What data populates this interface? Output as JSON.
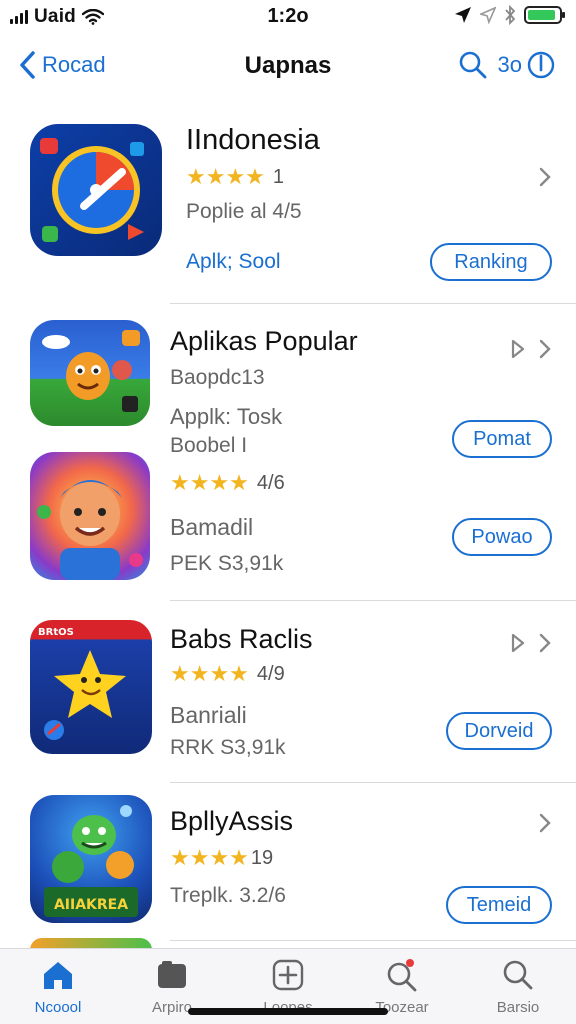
{
  "status_bar": {
    "carrier": "Uaid",
    "time": "1:2o",
    "icons": [
      "signal-icon",
      "wifi-icon",
      "location-icon",
      "bluetooth-icon",
      "battery-icon"
    ],
    "battery_level": 0.9,
    "battery_color": "#34c759"
  },
  "nav": {
    "back_label": "Rocad",
    "title": "Uapnas",
    "right_label": "3o"
  },
  "accent_color": "#1a6fd1",
  "apps": [
    {
      "title": "IIndonesia",
      "stars": "★★★★",
      "rating": "1",
      "subtitle": "Poplie al 4/5",
      "link": "Aplk; Sool",
      "button": "Ranking"
    },
    {
      "title": "Aplikas Popular",
      "line1": "Baopdc13",
      "line2": "Applk: Tosk",
      "line3": "Boobel I",
      "button": "Pomat"
    },
    {
      "stars": "★★★★",
      "rating": "4/6",
      "line1": "Bamadil",
      "line2": "PEK  S3,91k",
      "button": "Powao"
    },
    {
      "title": "Babs Raclis",
      "stars": "★★★★",
      "rating": "4/9",
      "line1": "Banriali",
      "line2": "RRK  S3,91k",
      "button": "Dorveid"
    },
    {
      "title": "BpllyAssis",
      "stars": "★★★★",
      "rating": "19",
      "line1": "Treplk. 3.2/6",
      "button": "Temeid",
      "icon_text": "AIIAKREA"
    }
  ],
  "tabs": [
    {
      "label": "Ncoool",
      "icon": "home-icon"
    },
    {
      "label": "Arpiro",
      "icon": "folder-icon"
    },
    {
      "label": "Loopes",
      "icon": "plus-icon"
    },
    {
      "label": "Toozear",
      "icon": "search-badge-icon"
    },
    {
      "label": "Barsio",
      "icon": "search-icon"
    }
  ]
}
